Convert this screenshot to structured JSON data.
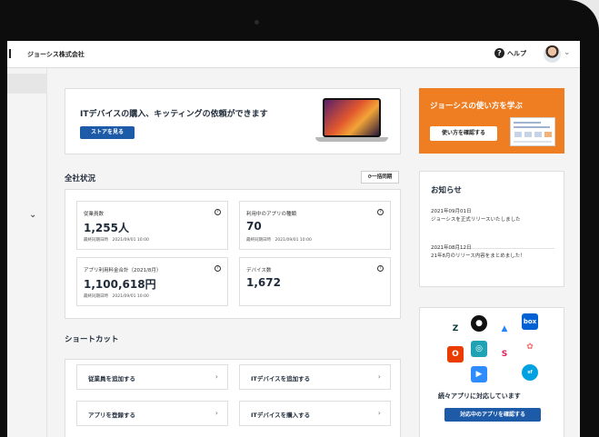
{
  "header": {
    "company": "ジョーシス株式会社",
    "help_label": "ヘルプ"
  },
  "banner": {
    "title": "ITデバイスの購入、キッティングの依頼ができます",
    "button": "ストアを見る"
  },
  "promo": {
    "title": "ジョーシスの使い方を学ぶ",
    "button": "使い方を確認する"
  },
  "status": {
    "title": "全社状況",
    "sync_button": "一括同期",
    "cards": [
      {
        "label": "従業員数",
        "value": "1,255人",
        "sub": "最終同期日時　2021/09/01 10:00"
      },
      {
        "label": "利用中のアプリの種類",
        "value": "70",
        "sub": "最終同期日時　2021/09/01 10:00"
      },
      {
        "label": "アプリ利用料金合計（2021/8月）",
        "value": "1,100,618円",
        "sub": "最終同期日時　2021/09/01 10:00"
      },
      {
        "label": "デバイス数",
        "value": "1,672",
        "sub": ""
      }
    ]
  },
  "news": {
    "title": "お知らせ",
    "items": [
      {
        "date": "2021年09月01日",
        "text": "ジョーシスを正式リリースいたしました"
      },
      {
        "date": "2021年08月12日",
        "text": "21年8月のリリース内容をまとめました！"
      }
    ]
  },
  "shortcuts": {
    "title": "ショートカット",
    "items": [
      "従業員を追加する",
      "ITデバイスを追加する",
      "アプリを登録する",
      "ITデバイスを購入する"
    ]
  },
  "apps": {
    "title": "続々アプリに対応しています",
    "button": "対応中のアプリを確認する",
    "icons": [
      "zendesk-icon",
      "github-icon",
      "atlassian-icon",
      "box-icon",
      "office-icon",
      "app-icon",
      "slack-icon",
      "asana-icon",
      "zoom-icon",
      "salesforce-icon"
    ]
  },
  "colors": {
    "accent_blue": "#1d5aa8",
    "accent_orange": "#ef7d22"
  }
}
